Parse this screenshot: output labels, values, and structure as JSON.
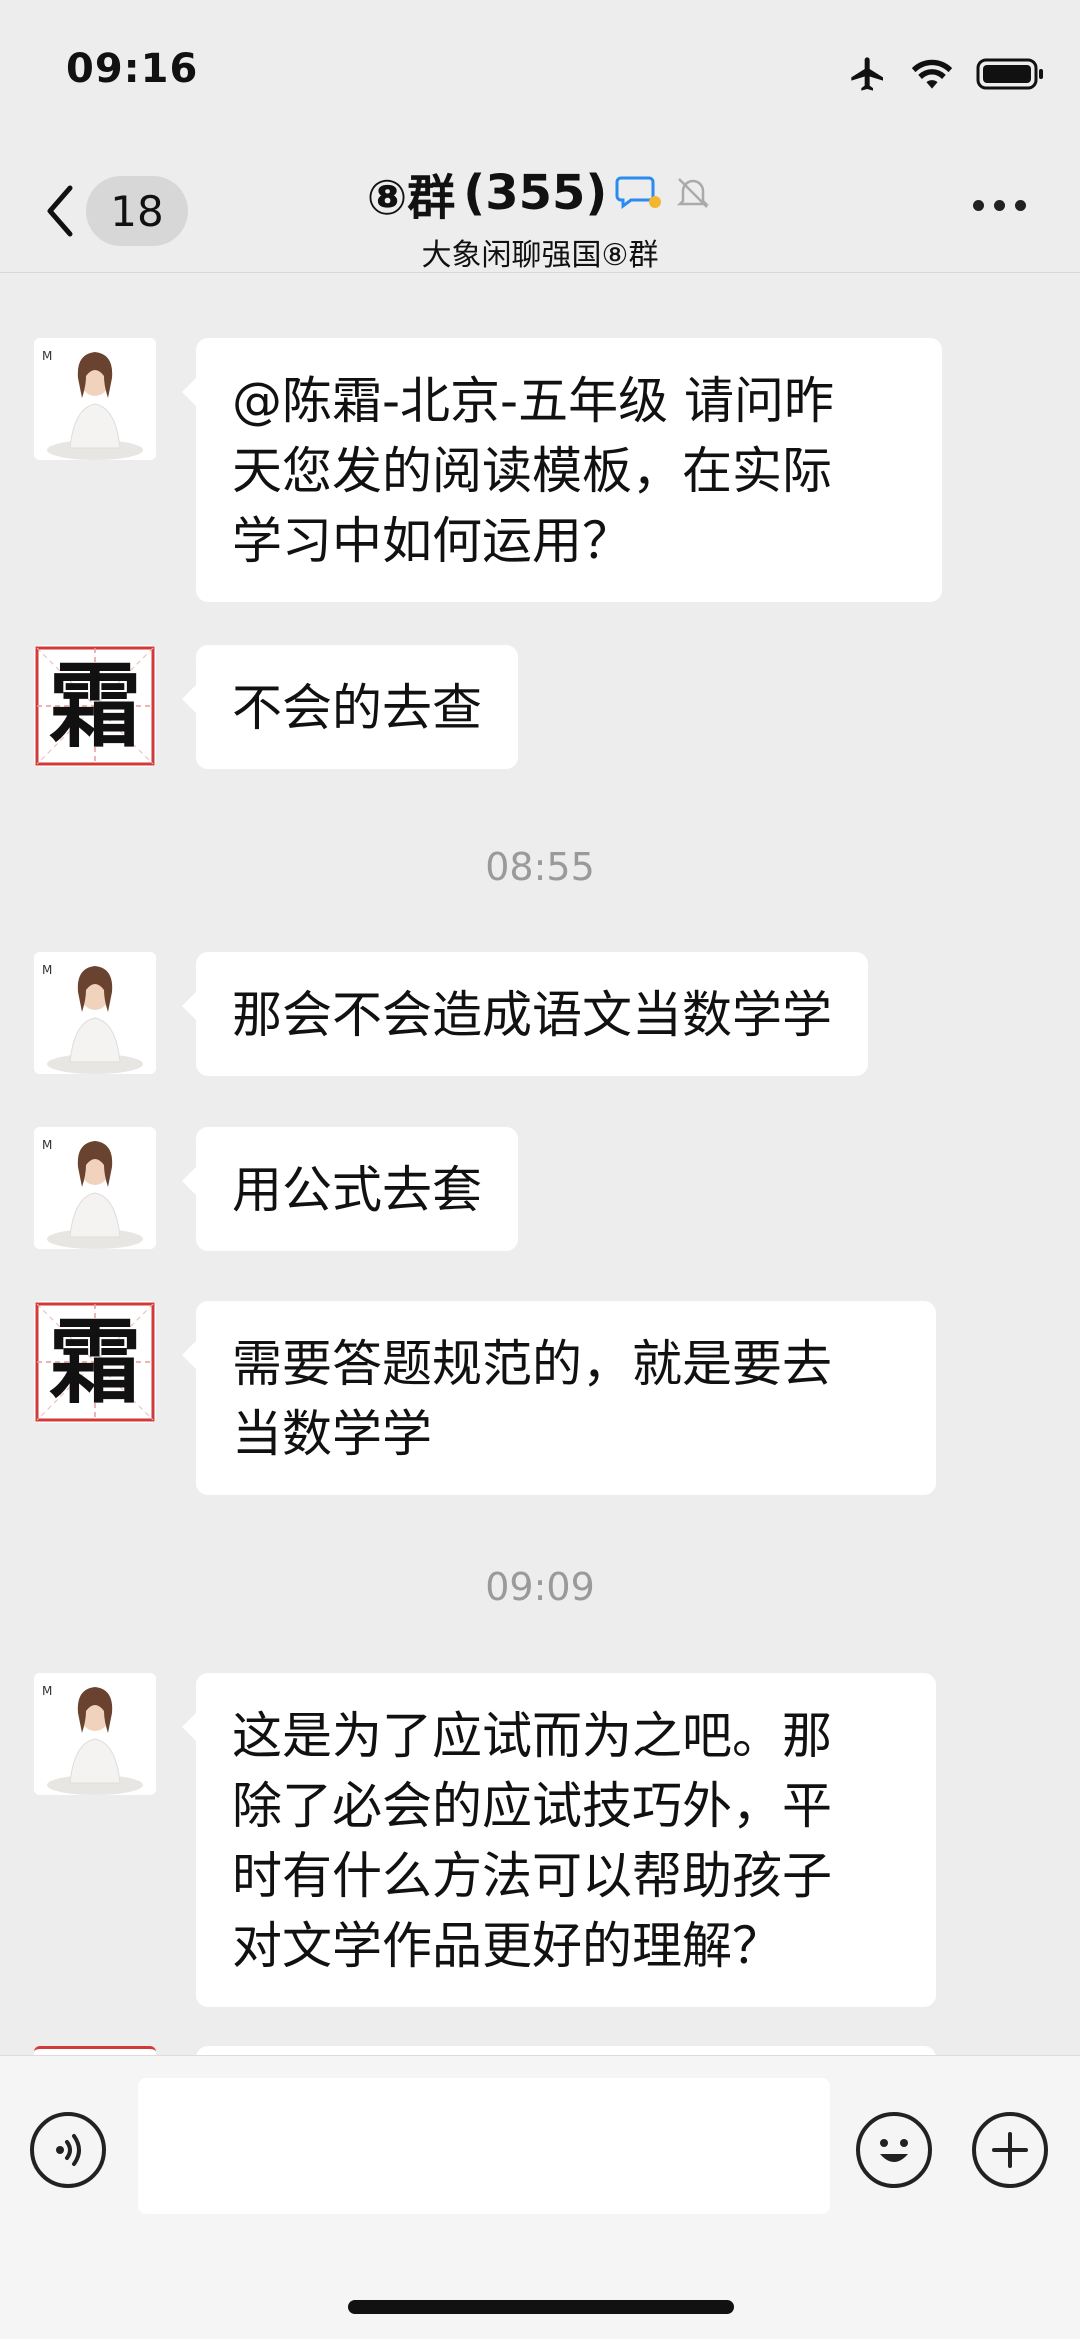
{
  "status_bar": {
    "time": "09:16"
  },
  "nav": {
    "back_count": "18",
    "title": "⑧群",
    "member_count": "(355)",
    "subtitle": "大象闲聊强国⑧群"
  },
  "colors": {
    "background": "#ededed",
    "bubble": "#ffffff",
    "timestamp": "#9a9a9a"
  },
  "messages": [
    {
      "sender": "woman-avatar",
      "text_lines": [
        "@陈霜-北京-五年级 请问昨",
        "天您发的阅读模板，在实际",
        "学习中如何运用？"
      ]
    },
    {
      "sender": "shuang-avatar",
      "text_lines": [
        "不会的去查"
      ]
    },
    {
      "timestamp": "08:55"
    },
    {
      "sender": "woman-avatar",
      "text_lines": [
        "那会不会造成语文当数学学"
      ]
    },
    {
      "sender": "woman-avatar",
      "text_lines": [
        "用公式去套"
      ]
    },
    {
      "sender": "shuang-avatar",
      "text_lines": [
        "需要答题规范的，就是要去",
        "当数学学"
      ]
    },
    {
      "timestamp": "09:09"
    },
    {
      "sender": "woman-avatar",
      "text_lines": [
        "这是为了应试而为之吧。那",
        "除了必会的应试技巧外，平",
        "时有什么方法可以帮助孩子",
        "对文学作品更好的理解？"
      ]
    }
  ],
  "avatar_glyph": "霜",
  "input_bar": {
    "value": ""
  }
}
